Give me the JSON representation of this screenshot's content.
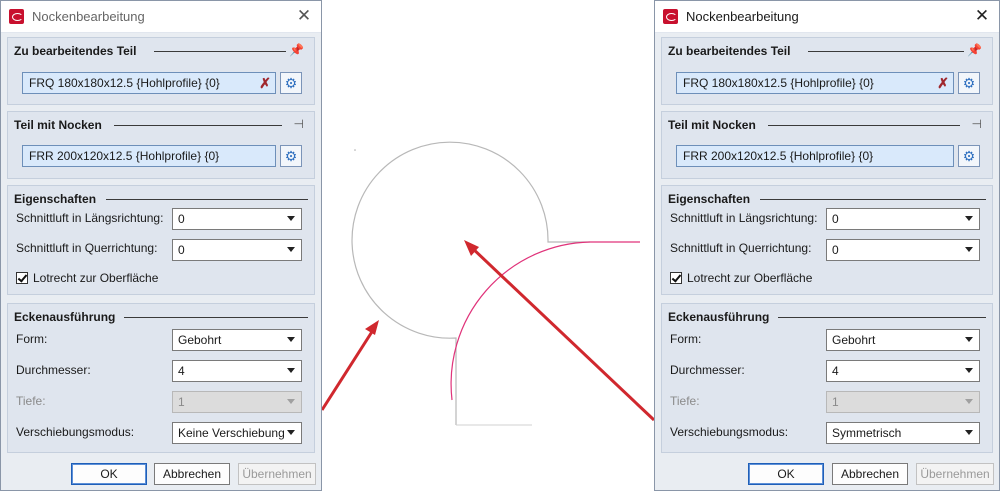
{
  "left_dialog": {
    "title": "Nockenbearbeitung",
    "section_part": {
      "label": "Zu bearbeitendes Teil",
      "value": "FRQ 180x180x12.5 {Hohlprofile} {0}"
    },
    "section_cam": {
      "label": "Teil mit Nocken",
      "value": "FRR 200x120x12.5 {Hohlprofile} {0}"
    },
    "section_props": {
      "label": "Eigenschaften",
      "longitudinal_label": "Schnittluft in Längsrichtung:",
      "longitudinal_value": "0",
      "transverse_label": "Schnittluft in Querrichtung:",
      "transverse_value": "0",
      "perpendicular_label": "Lotrecht zur Oberfläche",
      "perpendicular_checked": true
    },
    "section_corner": {
      "label": "Eckenausführung",
      "form_label": "Form:",
      "form_value": "Gebohrt",
      "diameter_label": "Durchmesser:",
      "diameter_value": "4",
      "depth_label": "Tiefe:",
      "depth_value": "1",
      "mode_label": "Verschiebungsmodus:",
      "mode_value": "Keine Verschiebung"
    },
    "buttons": {
      "ok": "OK",
      "cancel": "Abbrechen",
      "apply": "Übernehmen"
    }
  },
  "right_dialog": {
    "title": "Nockenbearbeitung",
    "section_part": {
      "label": "Zu bearbeitendes Teil",
      "value": "FRQ 180x180x12.5 {Hohlprofile} {0}"
    },
    "section_cam": {
      "label": "Teil mit Nocken",
      "value": "FRR 200x120x12.5 {Hohlprofile} {0}"
    },
    "section_props": {
      "label": "Eigenschaften",
      "longitudinal_label": "Schnittluft in Längsrichtung:",
      "longitudinal_value": "0",
      "transverse_label": "Schnittluft in Querrichtung:",
      "transverse_value": "0",
      "perpendicular_label": "Lotrecht zur Oberfläche",
      "perpendicular_checked": true
    },
    "section_corner": {
      "label": "Eckenausführung",
      "form_label": "Form:",
      "form_value": "Gebohrt",
      "diameter_label": "Durchmesser:",
      "diameter_value": "4",
      "depth_label": "Tiefe:",
      "depth_value": "1",
      "mode_label": "Verschiebungsmodus:",
      "mode_value": "Symmetrisch"
    },
    "buttons": {
      "ok": "OK",
      "cancel": "Abbrechen",
      "apply": "Übernehmen"
    }
  },
  "colors": {
    "accent": "#c8102e",
    "field_bg": "#d9e9fb",
    "profile_gray": "#b8b8b8",
    "profile_pink": "#e0337a",
    "arrow_red": "#d0282e"
  }
}
